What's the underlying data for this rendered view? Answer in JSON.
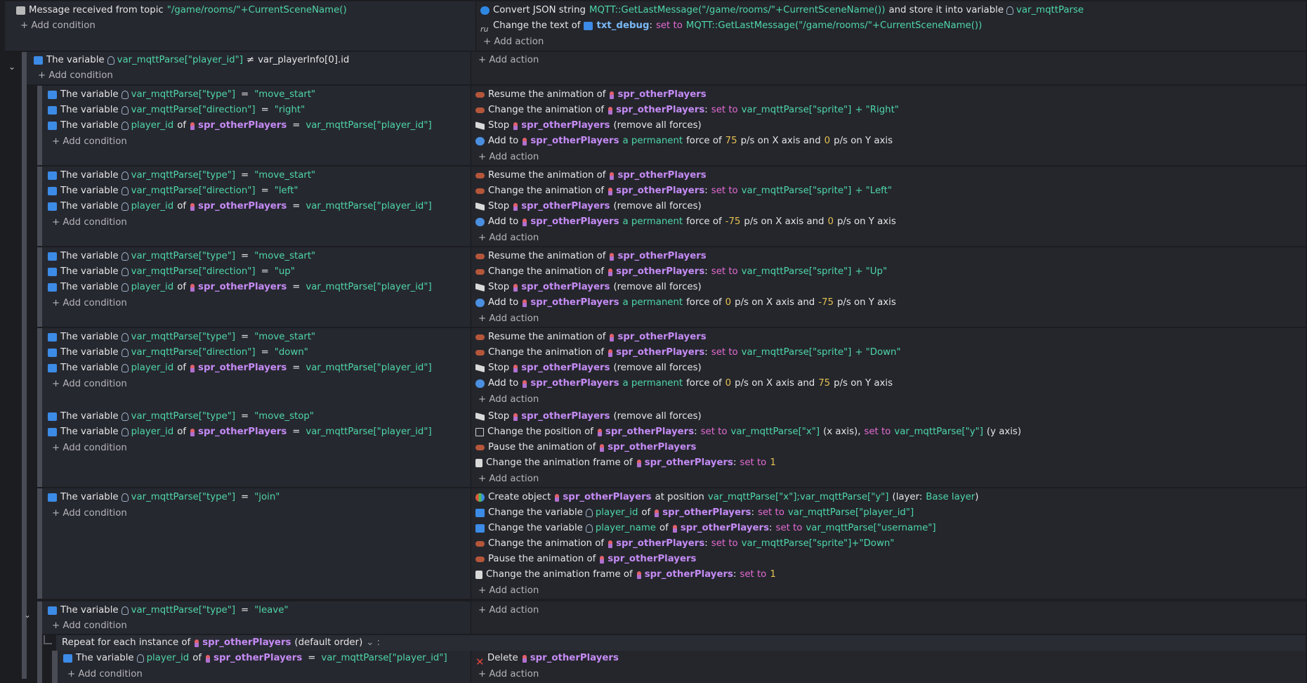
{
  "common": {
    "add_condition": "+ Add condition",
    "add_action": "+ Add action",
    "the_variable": "The variable",
    "of": "of",
    "resume_anim": "Resume the animation of",
    "change_anim": "Change the animation of",
    "set_to": "set to",
    "stop": "Stop",
    "remove_forces": "(remove all forces)",
    "add_to": "Add to",
    "a_permanent": "a permanent",
    "force_of": "force of",
    "px_x_and": "p/s on X axis and",
    "px_y": "p/s on Y axis",
    "obj": "spr_otherPlayers",
    "var_parse": "var_mqttParse",
    "player_id": "player_id",
    "sprite_expr": "var_mqttParse[\"sprite\"]",
    "player_id_expr": "var_mqttParse[\"player_id\"]",
    "type_key": "var_mqttParse[\"type\"]",
    "dir_key": "var_mqttParse[\"direction\"]",
    "eq": "="
  },
  "e0": {
    "cond_text": "Message received from topic",
    "cond_topic": "\"/game/rooms/\"+CurrentSceneName()",
    "a1_text": "Convert JSON string",
    "a1_expr": "MQTT::GetLastMessage(\"/game/rooms/\"+CurrentSceneName())",
    "a1_store": "and store it into variable",
    "a1_var": "var_mqttParse",
    "a2_text": "Change the text of",
    "a2_obj": "txt_debug",
    "a2_set": "set to",
    "a2_expr": "MQTT::GetLastMessage(\"/game/rooms/\"+CurrentSceneName())"
  },
  "e1": {
    "var": "var_mqttParse[\"player_id\"]",
    "neq": "≠",
    "rhs": "var_playerInfo[0].id"
  },
  "moves": [
    {
      "type": "\"move_start\"",
      "dir": "\"right\"",
      "suffix": "+ \"Right\"",
      "fx": "75",
      "fy": "0"
    },
    {
      "type": "\"move_start\"",
      "dir": "\"left\"",
      "suffix": "+ \"Left\"",
      "fx": "-75",
      "fy": "0"
    },
    {
      "type": "\"move_start\"",
      "dir": "\"up\"",
      "suffix": "+ \"Up\"",
      "fx": "0",
      "fy": "-75"
    },
    {
      "type": "\"move_start\"",
      "dir": "\"down\"",
      "suffix": "+ \"Down\"",
      "fx": "0",
      "fy": "75"
    }
  ],
  "stop_evt": {
    "type": "\"move_stop\"",
    "pos_text": "Change the position of",
    "pos_x": "var_mqttParse[\"x\"]",
    "x_axis": "(x axis),",
    "pos_y": "var_mqttParse[\"y\"]",
    "y_axis": "(y axis)",
    "pause": "Pause the animation of",
    "frame": "Change the animation frame of",
    "frame_val": "1"
  },
  "join_evt": {
    "type": "\"join\"",
    "create": "Create object",
    "at_pos": "at position",
    "pos_expr": "var_mqttParse[\"x\"];var_mqttParse[\"y\"]",
    "layer_open": "(layer:",
    "layer": "Base layer",
    "layer_close": ")",
    "change_var": "Change the variable",
    "player_name": "player_name",
    "username_expr": "var_mqttParse[\"username\"]",
    "anim_suffix": "+\"Down\"",
    "pause": "Pause the animation of",
    "frame": "Change the animation frame of",
    "frame_val": "1"
  },
  "leave_evt": {
    "type": "\"leave\"",
    "repeat_text": "Repeat for each instance of",
    "repeat_order": "(default order)",
    "repeat_menu": "⌄ :",
    "delete": "Delete"
  }
}
